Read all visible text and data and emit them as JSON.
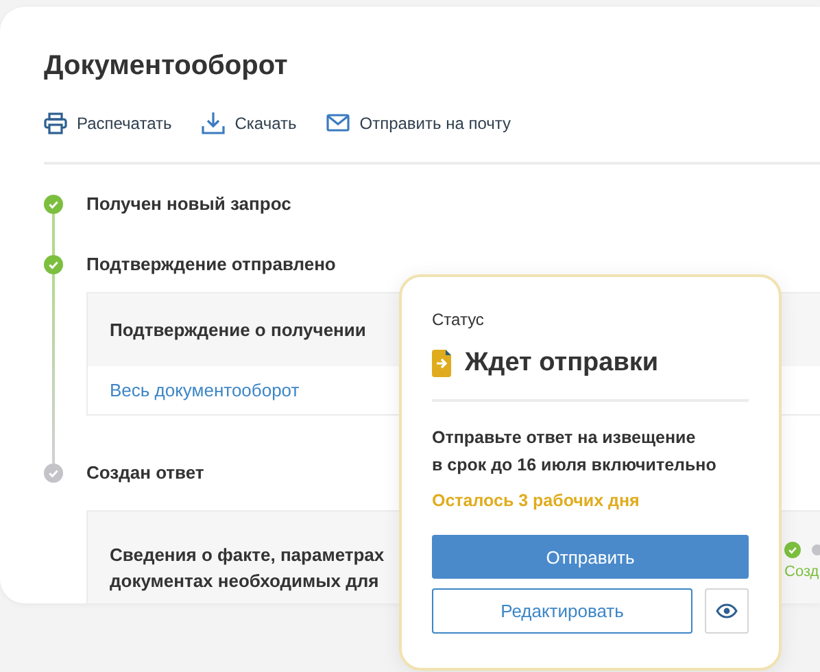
{
  "title": "Документооборот",
  "actions": [
    {
      "kind": "print",
      "label": "Распечатать"
    },
    {
      "kind": "download",
      "label": "Скачать"
    },
    {
      "kind": "mail",
      "label": "Отправить на почту"
    }
  ],
  "timeline": [
    {
      "title": "Получен новый запрос",
      "done": true
    },
    {
      "title": "Подтверждение отправлено",
      "done": true,
      "document": {
        "title_lines": [
          "Подтверждение о получении"
        ],
        "link": "Весь документооборот"
      }
    },
    {
      "title": "Создан ответ",
      "done": false,
      "document": {
        "title_lines": [
          "Сведения о факте, параметрах",
          "документах необходимых для"
        ],
        "status": {
          "steps": [
            {
              "done": true
            },
            {
              "done": false
            }
          ],
          "label": "Созд"
        }
      }
    }
  ],
  "status_popup": {
    "caption": "Статус",
    "title": "Ждет отправки",
    "message_lines": [
      "Отправьте ответ на извещение",
      "в срок до 16 июля включительно"
    ],
    "deadline": "Осталось 3 рабочих дня",
    "primary_button": "Отправить",
    "secondary_button": "Редактировать"
  }
}
